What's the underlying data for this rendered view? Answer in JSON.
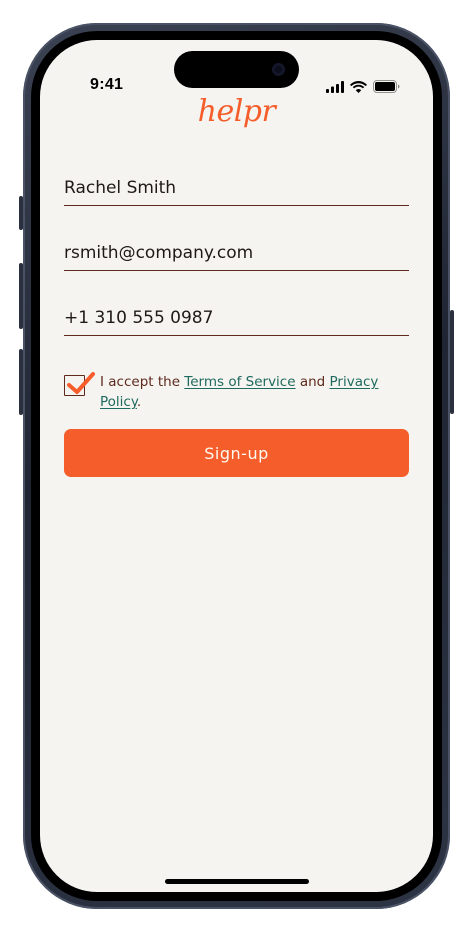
{
  "status_bar": {
    "time": "9:41"
  },
  "app": {
    "logo": "helpr"
  },
  "form": {
    "name_value": "Rachel Smith",
    "email_value": "rsmith@company.com",
    "phone_value": "+1 310 555 0987",
    "terms_checked": true,
    "terms_prefix": "I accept the ",
    "terms_link": "Terms of Service",
    "terms_and": " and ",
    "privacy_link": "Privacy Policy",
    "terms_suffix": ".",
    "submit_label": "Sign-up"
  },
  "colors": {
    "accent": "#f55d2b",
    "text_dark": "#5d2a1d",
    "link": "#1e6a5f",
    "background": "#f6f4f0"
  },
  "icons": [
    "signal-icon",
    "wifi-icon",
    "battery-icon",
    "checkmark-icon"
  ]
}
